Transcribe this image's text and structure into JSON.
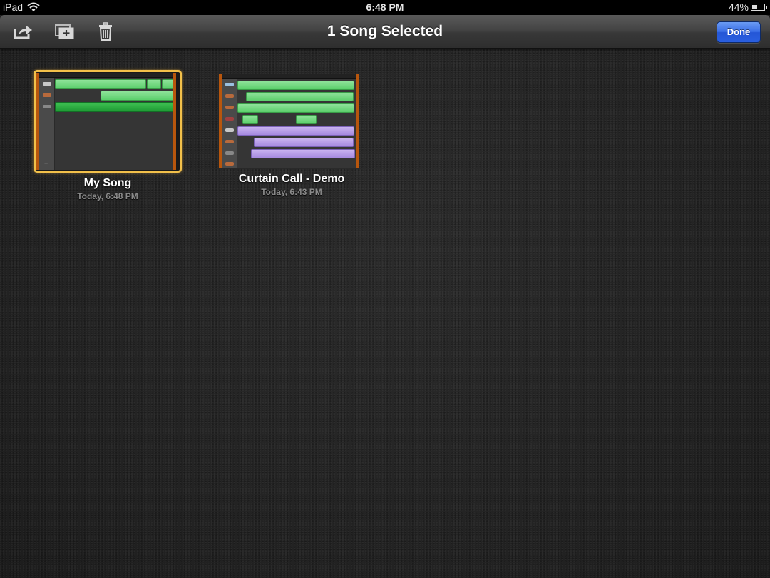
{
  "status_bar": {
    "carrier": "iPad",
    "time": "6:48 PM",
    "battery_percent": "44%",
    "battery_level": 0.44
  },
  "toolbar": {
    "title": "1 Song Selected",
    "done_label": "Done",
    "icons": [
      "share-icon",
      "duplicate-icon",
      "trash-icon"
    ]
  },
  "colors": {
    "selection": "#f2c04a",
    "done_button": "#2a5fe0",
    "region_green": "#5ccf6c",
    "region_purple": "#a68ae0"
  },
  "songs": [
    {
      "name": "My Song",
      "date": "Today, 6:48 PM",
      "selected": true
    },
    {
      "name": "Curtain Call - Demo",
      "date": "Today, 6:43 PM",
      "selected": false
    }
  ]
}
